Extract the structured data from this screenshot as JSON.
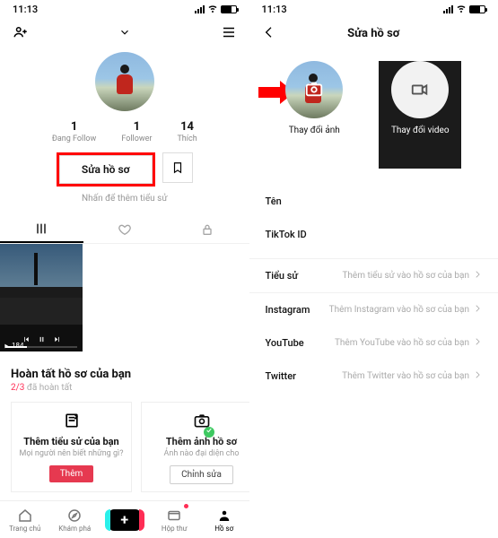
{
  "status": {
    "time": "11:13"
  },
  "left": {
    "stats": {
      "following": {
        "num": "1",
        "label": "Đang Follow"
      },
      "followers": {
        "num": "1",
        "label": "Follower"
      },
      "likes": {
        "num": "14",
        "label": "Thích"
      }
    },
    "edit_btn": "Sửa hồ sơ",
    "add_bio": "Nhấn để thêm tiểu sử",
    "video": {
      "views": "184"
    },
    "complete": {
      "title": "Hoàn tất hồ sơ của bạn",
      "progress_done": "2/3",
      "progress_rest": " đã hoàn tất",
      "card1": {
        "title": "Thêm tiểu sử của bạn",
        "sub": "Mọi người nên biết những gì?",
        "btn": "Thêm"
      },
      "card2": {
        "title": "Thêm ảnh hồ sơ",
        "sub": "Ảnh nào đại diện cho",
        "btn": "Chỉnh sửa"
      }
    },
    "tabs": {
      "home": "Trang chủ",
      "discover": "Khám phá",
      "inbox": "Hộp thư",
      "profile": "Hồ sơ"
    }
  },
  "right": {
    "title": "Sửa hồ sơ",
    "change_photo": "Thay đổi ảnh",
    "change_video": "Thay đổi video",
    "fields": {
      "name": "Tên",
      "tiktok_id": "TikTok ID",
      "bio": {
        "label": "Tiểu sử",
        "hint": "Thêm tiểu sử vào hồ sơ của bạn"
      },
      "instagram": {
        "label": "Instagram",
        "hint": "Thêm Instagram vào hồ sơ của bạn"
      },
      "youtube": {
        "label": "YouTube",
        "hint": "Thêm YouTube vào hồ sơ của bạn"
      },
      "twitter": {
        "label": "Twitter",
        "hint": "Thêm Twitter vào hồ sơ của bạn"
      }
    }
  }
}
